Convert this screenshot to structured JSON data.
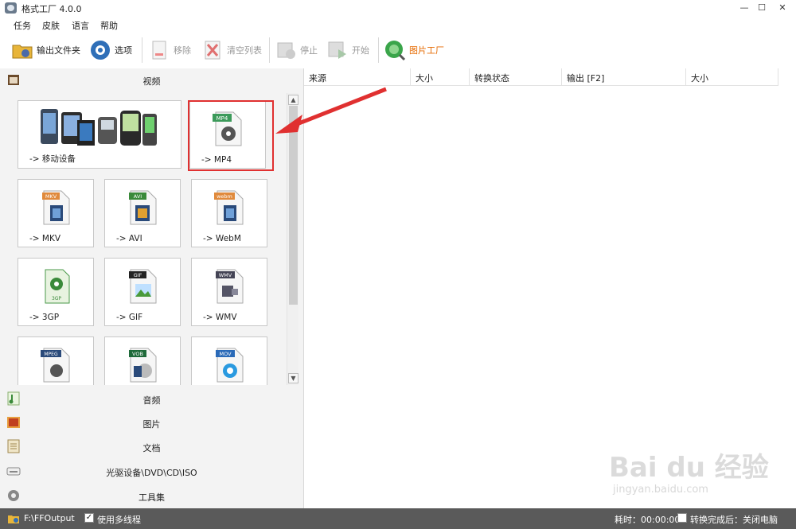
{
  "window": {
    "title": "格式工厂 4.0.0",
    "min": "—",
    "max": "☐",
    "close": "✕"
  },
  "menu": [
    "任务",
    "皮肤",
    "语言",
    "帮助"
  ],
  "toolbar": {
    "output_folder": "输出文件夹",
    "options": "选项",
    "remove": "移除",
    "clear_list": "清空列表",
    "stop": "停止",
    "start": "开始",
    "picture_factory": "图片工厂"
  },
  "categories": {
    "video": "视频",
    "audio": "音频",
    "picture": "图片",
    "document": "文档",
    "optical": "光驱设备\\DVD\\CD\\ISO",
    "tools": "工具集"
  },
  "tiles": [
    {
      "label": "-> 移动设备",
      "badge": ""
    },
    {
      "label": "-> MP4",
      "badge": "MP4"
    },
    {
      "label": "-> MKV",
      "badge": "MKV"
    },
    {
      "label": "-> AVI",
      "badge": "AVI"
    },
    {
      "label": "-> WebM",
      "badge": "webm"
    },
    {
      "label": "-> 3GP",
      "badge": "3GP"
    },
    {
      "label": "-> GIF",
      "badge": "GIF"
    },
    {
      "label": "-> WMV",
      "badge": "WMV"
    },
    {
      "label": "",
      "badge": "MPEG"
    },
    {
      "label": "",
      "badge": "VOB"
    },
    {
      "label": "",
      "badge": "MOV"
    }
  ],
  "columns": [
    "来源",
    "大小",
    "转换状态",
    "输出 [F2]",
    "大小"
  ],
  "status": {
    "output_path": "F:\\FFOutput",
    "multithread": "使用多线程",
    "elapsed": "耗时：00:00:00",
    "after_convert": "转换完成后：关闭电脑"
  },
  "watermark": {
    "brand": "Bai du 经验",
    "url": "jingyan.baidu.com"
  },
  "colors": {
    "accent_orange": "#e66a00",
    "highlight_red": "#e03030",
    "statusbar": "#5a5a5a"
  }
}
